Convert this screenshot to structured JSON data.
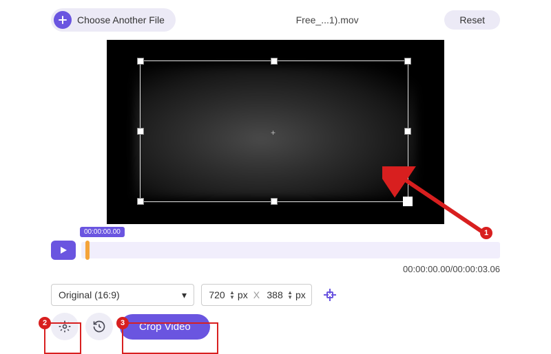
{
  "topbar": {
    "choose_label": "Choose Another File",
    "filename": "Free_...1).mov",
    "reset_label": "Reset"
  },
  "timeline": {
    "tooltip_time": "00:00:00.00",
    "readout": "00:00:00.00/00:00:03.06"
  },
  "controls": {
    "aspect_label": "Original (16:9)",
    "width_value": "720",
    "height_value": "388",
    "unit": "px"
  },
  "actions": {
    "crop_label": "Crop Video"
  },
  "annotations": {
    "b1": "1",
    "b2": "2",
    "b3": "3"
  }
}
